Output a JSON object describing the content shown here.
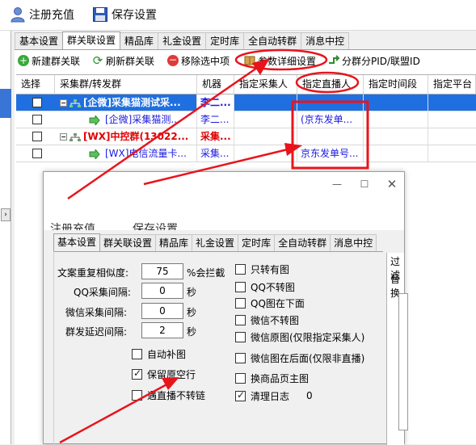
{
  "toolbar": {
    "register": "注册充值",
    "save": "保存设置"
  },
  "tabs": [
    "基本设置",
    "群关联设置",
    "精品库",
    "礼金设置",
    "定时库",
    "全自动转群",
    "消息中控"
  ],
  "actions": {
    "new": "新建群关联",
    "refresh": "刷新群关联",
    "remove": "移除选中项",
    "detail": "参数详细设置",
    "split": "分群分PID/联盟ID"
  },
  "columns": [
    "选择",
    "采集群/转发群",
    "机器",
    "指定采集人",
    "指定直播人",
    "指定时间段",
    "指定平台"
  ],
  "rows": [
    {
      "name": "[企微]采集猫测试采...",
      "robot": "李二...",
      "live": "",
      "selected": true
    },
    {
      "name": "[企微]采集猫测...",
      "robot": "李二...",
      "live": "(京东发单..."
    },
    {
      "name": "[WX]中控群(13022...",
      "robot": "采集...",
      "live": ""
    },
    {
      "name": "[WX]电信流量卡...",
      "robot": "采集...",
      "live": "京东发单号..."
    }
  ],
  "dialog": {
    "ghost_left": "注册充值",
    "ghost_right": "保存设置",
    "tabs": [
      "基本设置",
      "群关联设置",
      "精品库",
      "礼金设置",
      "定时库",
      "全自动转群",
      "消息中控"
    ],
    "fields": [
      {
        "label": "文案重复相似度:",
        "value": "75",
        "unit": "%会拦截"
      },
      {
        "label": "QQ采集间隔:",
        "value": "0",
        "unit": "秒"
      },
      {
        "label": "微信采集间隔:",
        "value": "0",
        "unit": "秒"
      },
      {
        "label": "群发延迟间隔:",
        "value": "2",
        "unit": "秒"
      }
    ],
    "left_checks": [
      {
        "label": "自动补图",
        "checked": false
      },
      {
        "label": "保留原空行",
        "checked": true
      },
      {
        "label": "遇直播不转链",
        "checked": false
      }
    ],
    "right_checks": [
      {
        "label": "只转有图",
        "checked": false
      },
      {
        "label": "QQ不转图",
        "checked": false
      },
      {
        "label": "QQ图在下面",
        "checked": false
      },
      {
        "label": "微信不转图",
        "checked": false
      },
      {
        "label": "微信原图(仅限指定采集人)",
        "checked": false
      },
      {
        "label": "微信图在后面(仅限非直播)",
        "checked": false
      },
      {
        "label": "换商品页主图",
        "checked": false
      },
      {
        "label": "清理日志",
        "checked": true
      }
    ],
    "log_count": "0",
    "right_panel_1": "过滤",
    "right_panel_2": "替换"
  },
  "colors": {
    "selected_row": "#1f6fe0",
    "group_red": "#e00000",
    "link_blue": "#1a1ae0",
    "annotation_red": "#e8141c"
  }
}
